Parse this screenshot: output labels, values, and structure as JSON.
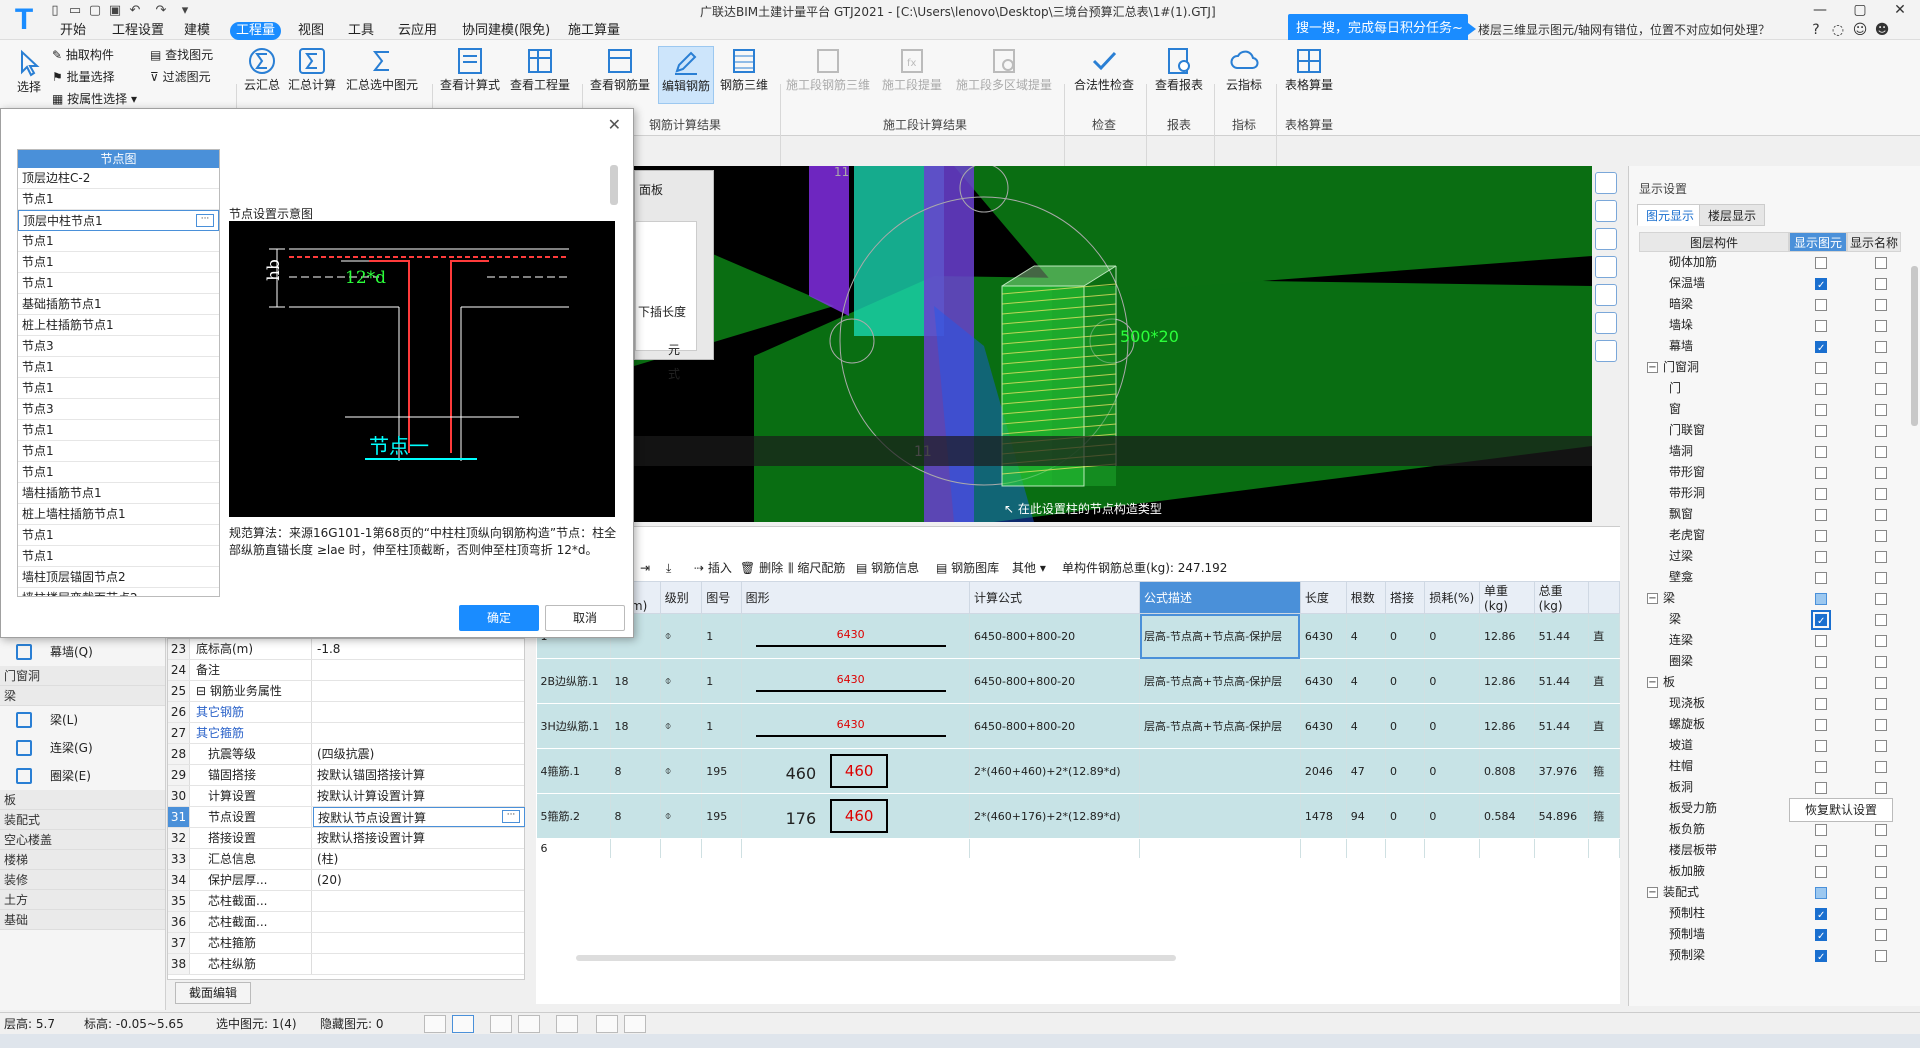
{
  "titlebar": {
    "app_title": "广联达BIM土建计量平台 GTJ2021 - [C:\\Users\\lenovo\\Desktop\\三境台预算汇总表\\1#(1).GTJ]",
    "search_banner": "搜一搜，完成每日积分任务~",
    "search_query": "楼层三维显示图元/轴网有错位，位置不对应如何处理？",
    "menu_tabs": [
      "开始",
      "工程设置",
      "建模",
      "工程量",
      "视图",
      "工具",
      "云应用",
      "协同建模(限免)",
      "施工算量"
    ],
    "active_tab": "工程量"
  },
  "ribbon": {
    "select": "选择",
    "pick": "抽取构件",
    "batch": "批量选择",
    "by_attr": "按属性选择",
    "find": "查找图元",
    "filter": "过滤图元",
    "cloud_sum": "云汇总",
    "sum_calc": "汇总计算",
    "sum_sel": "汇总选中图元",
    "view_formula": "查看计算式",
    "view_qty": "查看工程量",
    "view_rebar": "查看钢筋量",
    "edit_rebar": "编辑钢筋",
    "rebar_3d": "钢筋三维",
    "group_rebar": "钢筋计算结果",
    "stage_3d": "施工段钢筋三维",
    "stage_qty": "施工段提量",
    "stage_multi": "施工段多区域提量",
    "group_stage": "施工段计算结果",
    "check": "合法性检查",
    "group_check": "检查",
    "view_report": "查看报表",
    "group_report": "报表",
    "cloud_index": "云指标",
    "group_index": "指标",
    "table_calc": "表格算量",
    "group_table": "表格算量"
  },
  "dialog": {
    "list_header": "节点图",
    "items": [
      "顶层边柱C-2",
      "节点1",
      "顶层中柱节点1",
      "节点1",
      "节点1",
      "节点1",
      "基础插筋节点1",
      "桩上柱插筋节点1",
      "节点3",
      "节点1",
      "节点1",
      "节点3",
      "节点1",
      "节点1",
      "节点1",
      "墙柱插筋节点1",
      "桩上墙柱插筋节点1",
      "节点1",
      "节点1",
      "墙柱顶层锚固节点2",
      "墙柱楼层变截面节点2"
    ],
    "selected_index": 2,
    "diagram_title": "节点设置示意图",
    "diagram_hb": "hb",
    "diagram_anchor": "12*d",
    "diagram_caption": "节点一",
    "description": "规范算法：来源16G101-1第68页的“中柱柱顶纵向钢筋构造”节点：柱全部纵筋直锚长度 ≥lae 时，伸至柱顶截断，否则伸至柱顶弯折 12*d。",
    "ok": "确定",
    "cancel": "取消"
  },
  "left_tree": {
    "items": [
      {
        "type": "item",
        "label": "幕墙(Q)"
      },
      {
        "type": "cat",
        "label": "门窗洞"
      },
      {
        "type": "cat",
        "label": "梁"
      },
      {
        "type": "item",
        "label": "梁(L)"
      },
      {
        "type": "item",
        "label": "连梁(G)"
      },
      {
        "type": "item",
        "label": "圈梁(E)"
      },
      {
        "type": "cat",
        "label": "板"
      },
      {
        "type": "cat",
        "label": "装配式"
      },
      {
        "type": "cat",
        "label": "空心楼盖"
      },
      {
        "type": "cat",
        "label": "楼梯"
      },
      {
        "type": "cat",
        "label": "装修"
      },
      {
        "type": "cat",
        "label": "土方"
      },
      {
        "type": "cat",
        "label": "基础"
      }
    ]
  },
  "props": {
    "rows": [
      {
        "n": "23",
        "k": "底标高(m)",
        "v": "-1.8"
      },
      {
        "n": "24",
        "k": "备注",
        "v": ""
      },
      {
        "n": "25",
        "k": "⊟ 钢筋业务属性",
        "v": ""
      },
      {
        "n": "26",
        "k": "其它钢筋",
        "v": "",
        "blue": true
      },
      {
        "n": "27",
        "k": "其它箍筋",
        "v": "",
        "blue": true
      },
      {
        "n": "28",
        "k": "抗震等级",
        "v": "(四级抗震)"
      },
      {
        "n": "29",
        "k": "锚固搭接",
        "v": "按默认锚固搭接计算"
      },
      {
        "n": "30",
        "k": "计算设置",
        "v": "按默认计算设置计算"
      },
      {
        "n": "31",
        "k": "节点设置",
        "v": "按默认节点设置计算",
        "sel": true
      },
      {
        "n": "32",
        "k": "搭接设置",
        "v": "按默认搭接设置计算"
      },
      {
        "n": "33",
        "k": "汇总信息",
        "v": "(柱)"
      },
      {
        "n": "34",
        "k": "保护层厚...",
        "v": "(20)"
      },
      {
        "n": "35",
        "k": "芯柱截面...",
        "v": ""
      },
      {
        "n": "36",
        "k": "芯柱截面...",
        "v": ""
      },
      {
        "n": "37",
        "k": "芯柱箍筋",
        "v": ""
      },
      {
        "n": "38",
        "k": "芯柱纵筋",
        "v": ""
      }
    ],
    "section_edit": "截面编辑"
  },
  "viewport": {
    "hint": "在此设置柱的节点构造类型",
    "panel_frag": [
      "面板",
      "下插长度",
      "元",
      "式"
    ],
    "label_11": "11",
    "label_dim": "500*20"
  },
  "rebar": {
    "toolbar": [
      "插入",
      "删除",
      "缩尺配筋",
      "钢筋信息",
      "钢筋图库",
      "其他",
      "单构件钢筋总重(kg): 247.192"
    ],
    "columns": [
      "径(mm)",
      "级别",
      "图号",
      "图形",
      "计算公式",
      "公式描述",
      "长度",
      "根数",
      "搭接",
      "损耗(%)",
      "单重(kg)",
      "总重(kg)",
      ""
    ],
    "rows": [
      {
        "no": "1",
        "name": "",
        "dia": "",
        "grade": "⌽",
        "fig": "1",
        "shape_top": "",
        "shape": "6430",
        "formula": "6450-800+800-20",
        "desc": "层高-节点高+节点高-保护层",
        "len": "6430",
        "cnt": "4",
        "lap": "0",
        "loss": "0",
        "unit": "12.86",
        "total": "51.44",
        "x": "直"
      },
      {
        "no": "2",
        "name": "B边纵筋.1",
        "dia": "18",
        "grade": "⌽",
        "fig": "1",
        "shape_top": "",
        "shape": "6430",
        "formula": "6450-800+800-20",
        "desc": "层高-节点高+节点高-保护层",
        "len": "6430",
        "cnt": "4",
        "lap": "0",
        "loss": "0",
        "unit": "12.86",
        "total": "51.44",
        "x": "直"
      },
      {
        "no": "3",
        "name": "H边纵筋.1",
        "dia": "18",
        "grade": "⌽",
        "fig": "1",
        "shape_top": "",
        "shape": "6430",
        "formula": "6450-800+800-20",
        "desc": "层高-节点高+节点高-保护层",
        "len": "6430",
        "cnt": "4",
        "lap": "0",
        "loss": "0",
        "unit": "12.86",
        "total": "51.44",
        "x": "直"
      },
      {
        "no": "4",
        "name": "箍筋.1",
        "dia": "8",
        "grade": "⌽",
        "fig": "195",
        "shape_top": "460",
        "shape": "460",
        "formula": "2*(460+460)+2*(12.89*d)",
        "desc": "",
        "len": "2046",
        "cnt": "47",
        "lap": "0",
        "loss": "0",
        "unit": "0.808",
        "total": "37.976",
        "x": "箍"
      },
      {
        "no": "5",
        "name": "箍筋.2",
        "dia": "8",
        "grade": "⌽",
        "fig": "195",
        "shape_top": "176",
        "shape": "460",
        "formula": "2*(460+176)+2*(12.89*d)",
        "desc": "",
        "len": "1478",
        "cnt": "94",
        "lap": "0",
        "loss": "0",
        "unit": "0.584",
        "total": "54.896",
        "x": "箍"
      }
    ],
    "empty_row": "6"
  },
  "display": {
    "title": "显示设置",
    "tabs": [
      "图元显示",
      "楼层显示"
    ],
    "headers": [
      "图层构件",
      "显示图元",
      "显示名称"
    ],
    "rows": [
      {
        "label": "砌体加筋",
        "show": false
      },
      {
        "label": "保温墙",
        "show": true
      },
      {
        "label": "暗梁",
        "show": false
      },
      {
        "label": "墙垛",
        "show": false
      },
      {
        "label": "幕墙",
        "show": true
      },
      {
        "label": "门窗洞",
        "show": false,
        "cat": true
      },
      {
        "label": "门",
        "show": false
      },
      {
        "label": "窗",
        "show": false
      },
      {
        "label": "门联窗",
        "show": false
      },
      {
        "label": "墙洞",
        "show": false
      },
      {
        "label": "带形窗",
        "show": false
      },
      {
        "label": "带形洞",
        "show": false
      },
      {
        "label": "飘窗",
        "show": false
      },
      {
        "label": "老虎窗",
        "show": false
      },
      {
        "label": "过梁",
        "show": false
      },
      {
        "label": "壁龛",
        "show": false
      },
      {
        "label": "梁",
        "show": "part",
        "cat": true
      },
      {
        "label": "梁",
        "show": true,
        "selrow": true
      },
      {
        "label": "连梁",
        "show": false
      },
      {
        "label": "圈梁",
        "show": false
      },
      {
        "label": "板",
        "show": false,
        "cat": true
      },
      {
        "label": "现浇板",
        "show": false
      },
      {
        "label": "螺旋板",
        "show": false
      },
      {
        "label": "坡道",
        "show": false
      },
      {
        "label": "柱帽",
        "show": false
      },
      {
        "label": "板洞",
        "show": false
      },
      {
        "label": "板受力筋",
        "show": false
      },
      {
        "label": "板负筋",
        "show": false
      },
      {
        "label": "楼层板带",
        "show": false
      },
      {
        "label": "板加腋",
        "show": false
      },
      {
        "label": "装配式",
        "show": "part",
        "cat": true
      },
      {
        "label": "预制柱",
        "show": true
      },
      {
        "label": "预制墙",
        "show": true
      },
      {
        "label": "预制梁",
        "show": true
      }
    ],
    "restore": "恢复默认设置"
  },
  "status": {
    "floor_height_label": "层高:",
    "floor_height": "5.7",
    "elev_label": "标高:",
    "elev": "-0.05~5.65",
    "selected_label": "选中图元:",
    "selected": "1(4)",
    "hidden_label": "隐藏图元:",
    "hidden": "0"
  }
}
